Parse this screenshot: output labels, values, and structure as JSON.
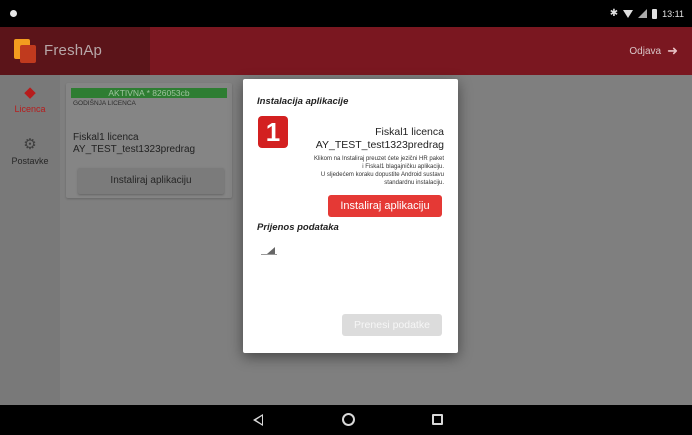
{
  "status_bar": {
    "time": "13:11",
    "icons": [
      "bluetooth-icon",
      "wifi-icon",
      "signal-icon",
      "battery-icon"
    ]
  },
  "app_bar": {
    "title": "FreshAp",
    "logout_label": "Odjava",
    "colors": {
      "bar": "#7a1720",
      "logo_orange": "#f39c1f",
      "logo_red": "#c03a1e"
    }
  },
  "sidebar": {
    "items": [
      {
        "label": "Licenca",
        "icon": "layers-icon",
        "active": true
      },
      {
        "label": "Postavke",
        "icon": "gear-icon",
        "active": false
      }
    ]
  },
  "license_card": {
    "status": "AKTIVNA * 826053cb",
    "type": "GODIŠNJA LICENCA",
    "name": "Fiskal1 licenca",
    "user": "AY_TEST_test1323predrag",
    "install_button": "Instaliraj aplikaciju",
    "status_color": "#2e7d32"
  },
  "dialog": {
    "title": "Instalacija aplikacije",
    "logo_text": "1",
    "license_name": "Fiskal1 licenca",
    "user": "AY_TEST_test1323predrag",
    "info_lines": [
      "Klikom na Instaliraj preuzet ćete jezični HR paket",
      "i Fiskal1 blagajničku aplikaciju.",
      "U sljedećem koraku dopustite Android sustavu",
      "standardnu instalaciju."
    ],
    "install_button": "Instaliraj aplikaciju",
    "transfer_section_title": "Prijenos podataka",
    "transfer_button": "Prenesi podatke",
    "accent_color": "#e53935"
  },
  "nav_bar": {
    "buttons": [
      "back-icon",
      "home-icon",
      "recents-icon"
    ]
  }
}
